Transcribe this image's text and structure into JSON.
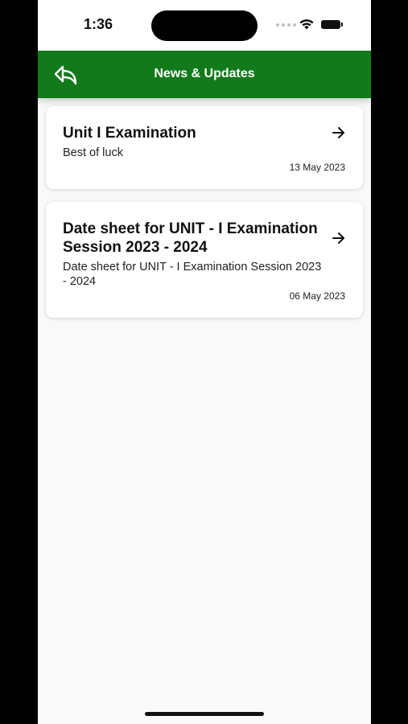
{
  "status": {
    "time": "1:36"
  },
  "header": {
    "title": "News & Updates",
    "back_icon": "reply-back-icon",
    "color": "#137a1c"
  },
  "news": [
    {
      "title": "Unit I Examination",
      "description": "Best of luck",
      "date": "13 May 2023"
    },
    {
      "title": "Date sheet for UNIT - I Examination Session 2023 - 2024",
      "description": "Date sheet for UNIT - I Examination Session 2023 - 2024",
      "date": "06 May 2023"
    }
  ]
}
